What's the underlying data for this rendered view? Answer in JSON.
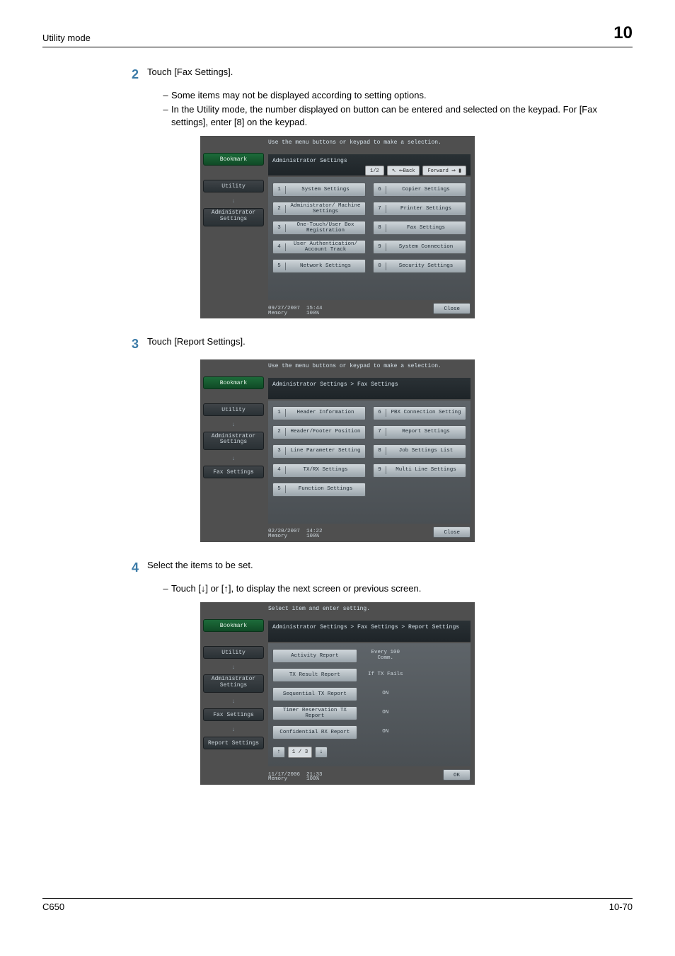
{
  "page": {
    "header_left": "Utility mode",
    "header_right": "10",
    "footer_left": "C650",
    "footer_right": "10-70"
  },
  "steps": {
    "s2": {
      "num": "2",
      "text": "Touch [Fax Settings].",
      "bullets": [
        "Some items may not be displayed according to setting options.",
        "In the Utility mode, the number displayed on button can be entered and selected on the keypad. For [Fax settings], enter [8] on the keypad."
      ]
    },
    "s3": {
      "num": "3",
      "text": "Touch [Report Settings]."
    },
    "s4": {
      "num": "4",
      "text": "Select the items to be set.",
      "bullets": [
        "Touch [↓] or [↑], to display the next screen or previous screen."
      ]
    }
  },
  "screen1": {
    "msg": "Use the menu buttons or keypad to make a selection.",
    "crumb": "Administrator Settings",
    "page": "1/2",
    "back": "↖ ⇐Back",
    "fwd": "Forward ⇒ ▮",
    "sidebar": {
      "bookmark": "Bookmark",
      "utility": "Utility",
      "admin": "Administrator Settings"
    },
    "left": [
      {
        "n": "1",
        "l": "System Settings"
      },
      {
        "n": "2",
        "l": "Administrator/ Machine Settings"
      },
      {
        "n": "3",
        "l": "One-Touch/User Box Registration"
      },
      {
        "n": "4",
        "l": "User Authentication/ Account Track"
      },
      {
        "n": "5",
        "l": "Network Settings"
      }
    ],
    "right": [
      {
        "n": "6",
        "l": "Copier Settings"
      },
      {
        "n": "7",
        "l": "Printer Settings"
      },
      {
        "n": "8",
        "l": "Fax Settings"
      },
      {
        "n": "9",
        "l": "System Connection"
      },
      {
        "n": "0",
        "l": "Security Settings"
      }
    ],
    "footer": {
      "date": "09/27/2007",
      "time": "15:44",
      "mem": "Memory",
      "memval": "100%",
      "close": "Close"
    }
  },
  "screen2": {
    "msg": "Use the menu buttons or keypad to make a selection.",
    "crumb": "Administrator Settings  >  Fax Settings",
    "sidebar": {
      "bookmark": "Bookmark",
      "utility": "Utility",
      "admin": "Administrator Settings",
      "fax": "Fax Settings"
    },
    "left": [
      {
        "n": "1",
        "l": "Header Information"
      },
      {
        "n": "2",
        "l": "Header/Footer Position"
      },
      {
        "n": "3",
        "l": "Line Parameter Setting"
      },
      {
        "n": "4",
        "l": "TX/RX Settings"
      },
      {
        "n": "5",
        "l": "Function Settings"
      }
    ],
    "right": [
      {
        "n": "6",
        "l": "PBX Connection Setting"
      },
      {
        "n": "7",
        "l": "Report Settings"
      },
      {
        "n": "8",
        "l": "Job Settings List"
      },
      {
        "n": "9",
        "l": "Multi Line Settings"
      }
    ],
    "footer": {
      "date": "02/20/2007",
      "time": "14:22",
      "mem": "Memory",
      "memval": "100%",
      "close": "Close"
    }
  },
  "screen3": {
    "msg": "Select item and enter setting.",
    "crumb": "Administrator Settings > Fax Settings > Report Settings",
    "sidebar": {
      "bookmark": "Bookmark",
      "utility": "Utility",
      "admin": "Administrator Settings",
      "fax": "Fax Settings",
      "report": "Report Settings"
    },
    "rows": [
      {
        "l": "Activity Report",
        "v": "Every 100 Comm."
      },
      {
        "l": "TX Result Report",
        "v": "If TX Fails"
      },
      {
        "l": "Sequential TX Report",
        "v": "ON"
      },
      {
        "l": "Timer Reservation TX Report",
        "v": "ON"
      },
      {
        "l": "Confidential RX Report",
        "v": "ON"
      }
    ],
    "pager": {
      "up": "↑",
      "count": "1 / 3",
      "down": "↓"
    },
    "footer": {
      "date": "11/17/2006",
      "time": "21:33",
      "mem": "Memory",
      "memval": "100%",
      "ok": "OK"
    }
  }
}
